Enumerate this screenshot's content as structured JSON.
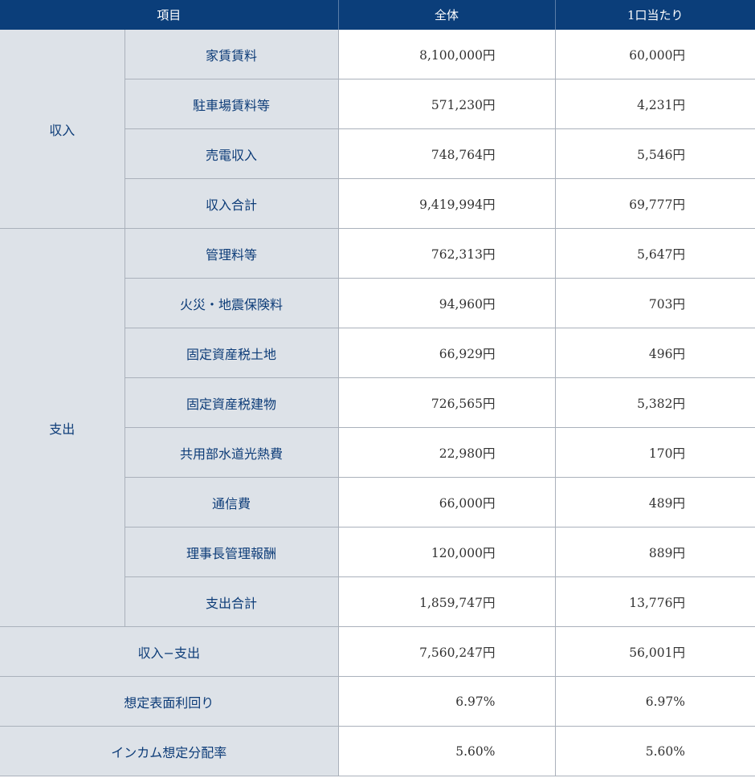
{
  "header": {
    "item": "項目",
    "total": "全体",
    "per_unit": "1口当たり"
  },
  "income": {
    "label": "収入",
    "rows": [
      {
        "name": "家賃賃料",
        "total": "8,100,000円",
        "per": "60,000円"
      },
      {
        "name": "駐車場賃料等",
        "total": "571,230円",
        "per": "4,231円"
      },
      {
        "name": "売電収入",
        "total": "748,764円",
        "per": "5,546円"
      },
      {
        "name": "収入合計",
        "total": "9,419,994円",
        "per": "69,777円"
      }
    ]
  },
  "expense": {
    "label": "支出",
    "rows": [
      {
        "name": "管理料等",
        "total": "762,313円",
        "per": "5,647円"
      },
      {
        "name": "火災・地震保険料",
        "total": "94,960円",
        "per": "703円"
      },
      {
        "name": "固定資産税土地",
        "total": "66,929円",
        "per": "496円"
      },
      {
        "name": "固定資産税建物",
        "total": "726,565円",
        "per": "5,382円"
      },
      {
        "name": "共用部水道光熱費",
        "total": "22,980円",
        "per": "170円"
      },
      {
        "name": "通信費",
        "total": "66,000円",
        "per": "489円"
      },
      {
        "name": "理事長管理報酬",
        "total": "120,000円",
        "per": "889円"
      },
      {
        "name": "支出合計",
        "total": "1,859,747円",
        "per": "13,776円"
      }
    ]
  },
  "summary": [
    {
      "name": "収入−支出",
      "total": "7,560,247円",
      "per": "56,001円"
    },
    {
      "name": "想定表面利回り",
      "total": "6.97%",
      "per": "6.97%"
    },
    {
      "name": "インカム想定分配率",
      "total": "5.60%",
      "per": "5.60%"
    }
  ]
}
